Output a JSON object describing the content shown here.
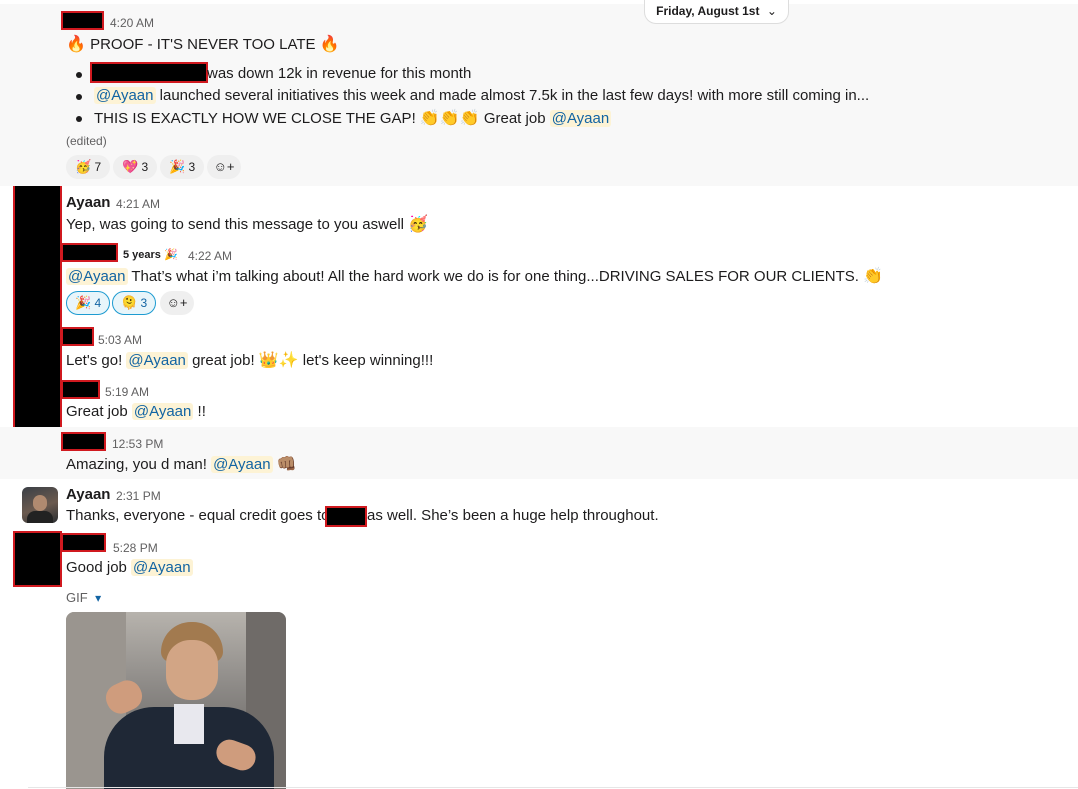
{
  "date_divider": {
    "label": "Friday, August 1st",
    "chevron": "⌄"
  },
  "messages": {
    "m1": {
      "time": "4:20 AM",
      "title_emoji_left": "🔥",
      "title": "PROOF - IT'S NEVER TOO LATE",
      "title_emoji_right": "🔥",
      "bullet1": "was down 12k in revenue for this month",
      "bullet2_mention": "@Ayaan",
      "bullet2": " launched several initiatives this week and made almost 7.5k in the last few days! with more still coming in...",
      "bullet3": "THIS IS EXACTLY HOW WE CLOSE THE GAP!",
      "bullet3_emoji": "👏👏👏",
      "bullet3_tail": " Great job ",
      "bullet3_mention": "@Ayaan",
      "edited": "(edited)",
      "reactions": [
        {
          "emoji": "🥳",
          "count": "7"
        },
        {
          "emoji": "💖",
          "count": "3"
        },
        {
          "emoji": "🎉",
          "count": "3"
        }
      ]
    },
    "m2": {
      "name": "Ayaan",
      "time": "4:21 AM",
      "text": "Yep, was going to send this message to you aswell",
      "emoji": "🥳"
    },
    "m3": {
      "badge": "5 years 🎉",
      "time": "4:22 AM",
      "mention": "@Ayaan",
      "text": " That’s what i’m talking about! All the hard work we do is for one thing...DRIVING SALES FOR OUR CLIENTS.",
      "emoji": "👏",
      "reactions": [
        {
          "emoji": "🎉",
          "count": "4"
        },
        {
          "emoji": "🫠",
          "count": "3"
        }
      ]
    },
    "m4": {
      "time": "5:03 AM",
      "pre": "Let's go! ",
      "mention": "@Ayaan",
      "mid": " great job! ",
      "emoji": "👑✨",
      "post": " let's keep winning!!!"
    },
    "m5": {
      "time": "5:19 AM",
      "pre": "Great job ",
      "mention": "@Ayaan",
      "post": " !!"
    },
    "m6": {
      "time": "12:53 PM",
      "pre": "Amazing, you d man! ",
      "mention": "@Ayaan",
      "emoji": "👊🏽"
    },
    "m7": {
      "name": "Ayaan",
      "time": "2:31 PM",
      "pre": "Thanks, everyone - equal credit goes to",
      "post": "as well. She’s been a huge help throughout."
    },
    "m8": {
      "time": "5:28 PM",
      "pre": "Good job ",
      "mention": "@Ayaan",
      "gif_label": "GIF",
      "gif_caret": "▾"
    }
  },
  "add_reaction_icon": "☺+"
}
